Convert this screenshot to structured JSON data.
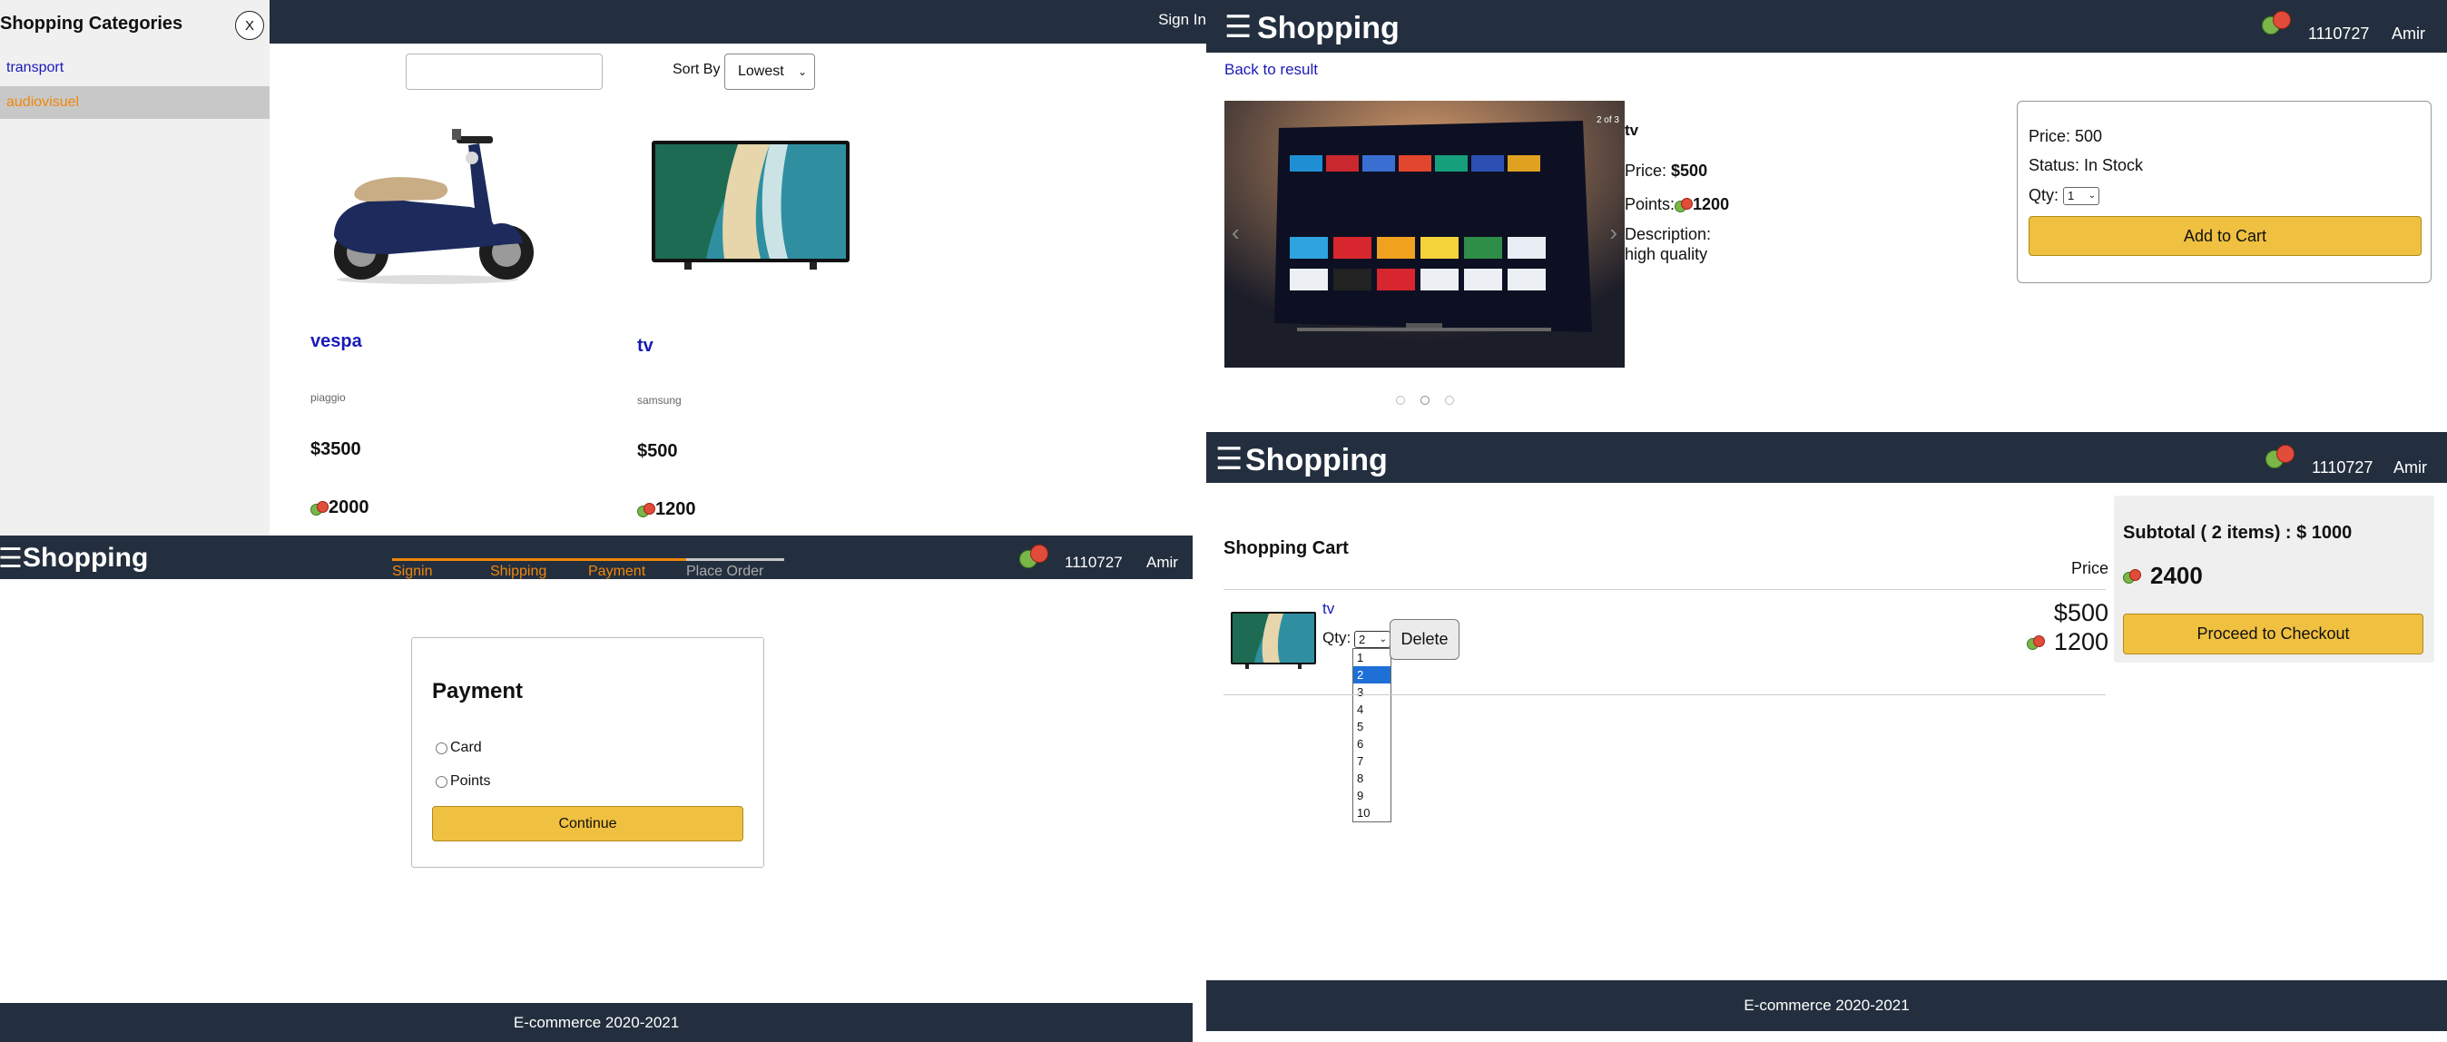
{
  "colors": {
    "navbar": "#232f3e",
    "accent_orange": "#f0870b",
    "link_blue": "#1a1ab8",
    "button_yellow": "#f0c040",
    "selected_option_blue": "#1e70d6"
  },
  "catalog": {
    "topbar": {
      "signin_label": "Sign In"
    },
    "sidebar": {
      "title": "Shopping Categories",
      "close_label": "X",
      "categories": [
        {
          "label": "transport",
          "selected": false
        },
        {
          "label": "audiovisuel",
          "selected": true
        }
      ]
    },
    "search": {
      "value": "",
      "placeholder": ""
    },
    "sort": {
      "label": "Sort By",
      "selected": "Lowest"
    },
    "products": [
      {
        "name": "vespa",
        "brand": "piaggio",
        "price": "$3500",
        "points": "2000",
        "image": "scooter-image"
      },
      {
        "name": "tv",
        "brand": "samsung",
        "price": "$500",
        "points": "1200",
        "image": "tv-image"
      }
    ]
  },
  "product_detail": {
    "header": {
      "brand": "Shopping",
      "user_id": "1110727",
      "user_name": "Amir"
    },
    "back_label": "Back to result",
    "carousel": {
      "counter": "2 of 3",
      "slide_count": 3,
      "active_slide": 2
    },
    "name": "tv",
    "price_label": "Price:",
    "price": "$500",
    "points_label": "Points:",
    "points": "1200",
    "description_label": "Description:",
    "description": "high quality",
    "buybox": {
      "price": "Price: 500",
      "status": "Status: In Stock",
      "qty_label": "Qty:",
      "qty_value": "1",
      "add_to_cart_label": "Add to Cart"
    }
  },
  "payment": {
    "header": {
      "brand": "Shopping",
      "user_id": "1110727",
      "user_name": "Amir"
    },
    "steps": [
      {
        "label": "Signin",
        "done": true
      },
      {
        "label": "Shipping",
        "done": true
      },
      {
        "label": "Payment",
        "done": true
      },
      {
        "label": "Place Order",
        "done": false
      }
    ],
    "title": "Payment",
    "options": [
      {
        "label": "Card",
        "checked": false
      },
      {
        "label": "Points",
        "checked": false
      }
    ],
    "continue_label": "Continue",
    "footer": "E-commerce 2020-2021"
  },
  "cart": {
    "header": {
      "brand": "Shopping",
      "user_id": "1110727",
      "user_name": "Amir"
    },
    "title": "Shopping Cart",
    "price_column_label": "Price",
    "item": {
      "name": "tv",
      "qty_label": "Qty:",
      "qty_value": "2",
      "qty_options": [
        "1",
        "2",
        "3",
        "4",
        "5",
        "6",
        "7",
        "8",
        "9",
        "10"
      ],
      "delete_label": "Delete",
      "price": "$500",
      "points": "1200"
    },
    "subtotal": "Subtotal ( 2 items) : $ 1000",
    "subtotal_points": "2400",
    "checkout_label": "Proceed to Checkout",
    "footer": "E-commerce 2020-2021"
  }
}
